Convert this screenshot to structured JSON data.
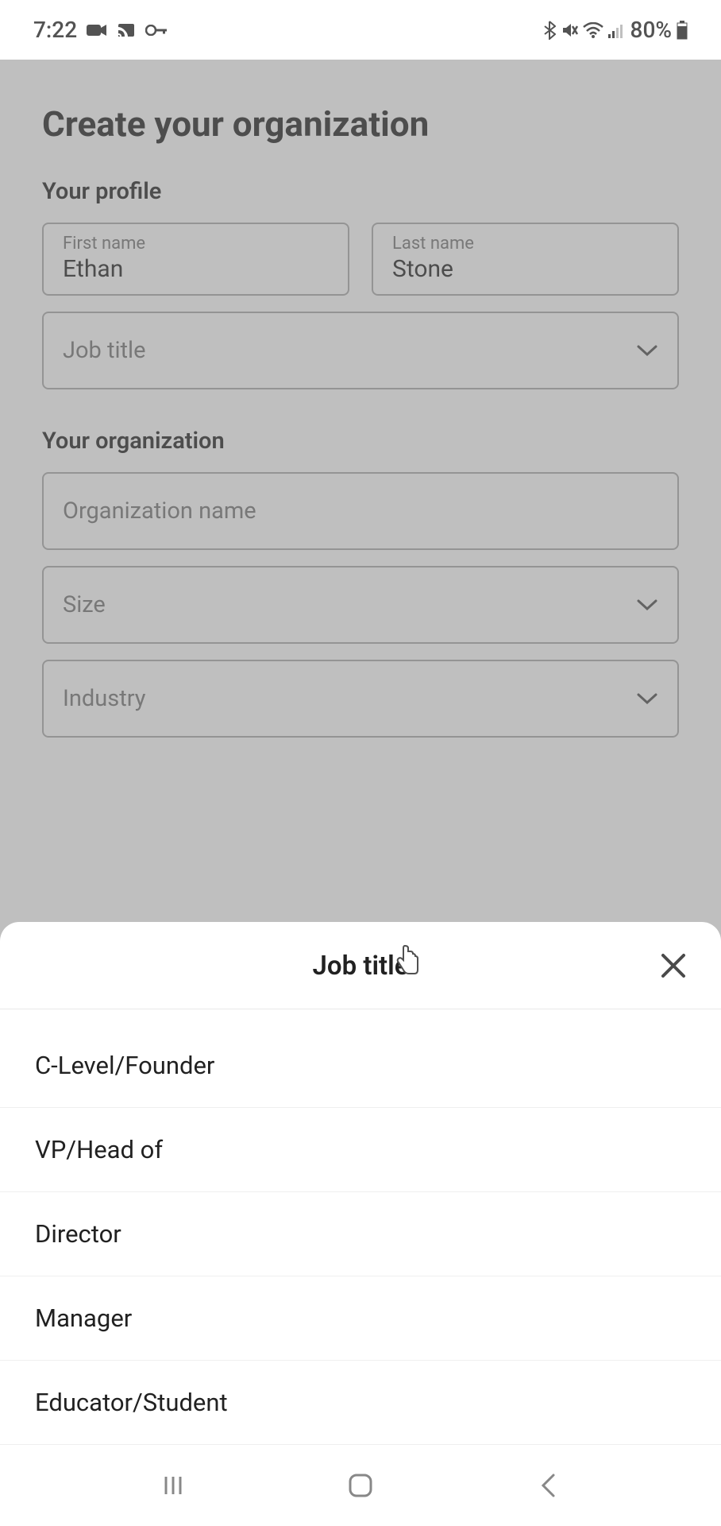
{
  "status_bar": {
    "time": "7:22",
    "battery_percent": "80%"
  },
  "page": {
    "title": "Create your organization"
  },
  "profile": {
    "section_title": "Your profile",
    "first_name_label": "First name",
    "first_name_value": "Ethan",
    "last_name_label": "Last name",
    "last_name_value": "Stone",
    "job_title_placeholder": "Job title"
  },
  "organization": {
    "section_title": "Your organization",
    "name_placeholder": "Organization name",
    "size_placeholder": "Size",
    "industry_placeholder": "Industry"
  },
  "bottom_sheet": {
    "title": "Job title",
    "options": [
      "C-Level/Founder",
      "VP/Head of",
      "Director",
      "Manager",
      "Educator/Student"
    ]
  }
}
